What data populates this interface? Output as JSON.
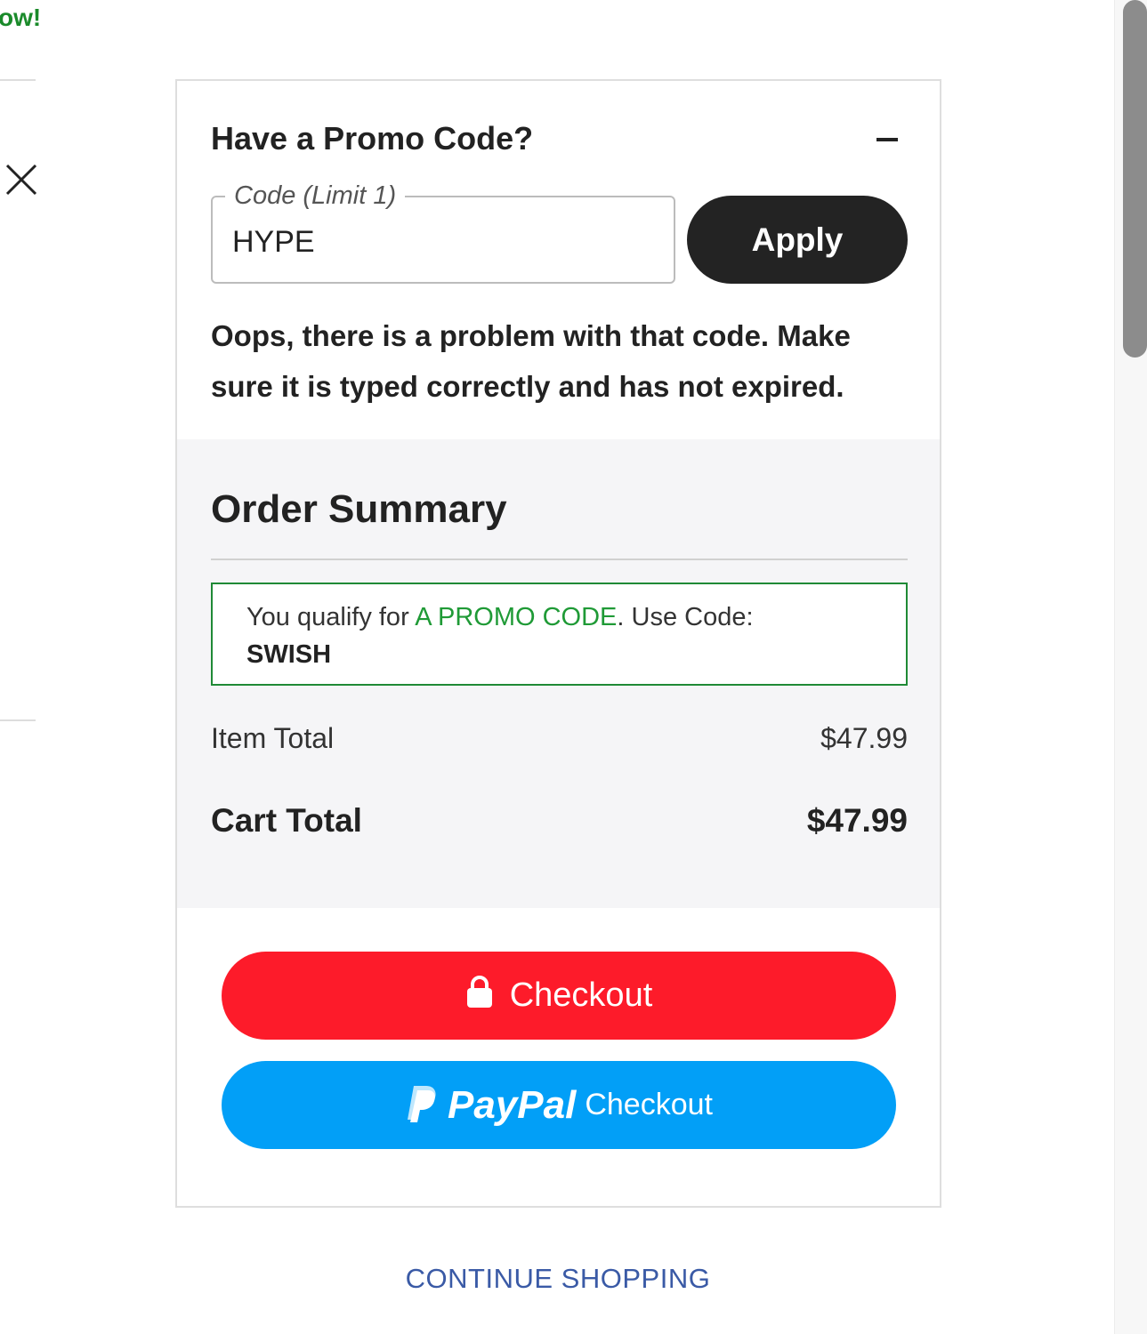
{
  "background": {
    "left_fragment_text": "ow!"
  },
  "promo": {
    "title": "Have a Promo Code?",
    "code_label": "Code (Limit 1)",
    "code_value": "HYPE",
    "apply_label": "Apply",
    "error_message": "Oops, there is a problem with that code. Make sure it is typed correctly and has not expired."
  },
  "summary": {
    "title": "Order Summary",
    "qualify_prefix": "You qualify for ",
    "qualify_highlight": "A PROMO CODE",
    "qualify_suffix": ". Use Code:",
    "qualify_code": "SWISH",
    "item_total_label": "Item Total",
    "item_total_value": "$47.99",
    "cart_total_label": "Cart Total",
    "cart_total_value": "$47.99"
  },
  "actions": {
    "checkout_label": "Checkout",
    "paypal_brand": "PayPal",
    "paypal_label": "Checkout",
    "continue_label": "CONTINUE SHOPPING"
  },
  "colors": {
    "checkout_red": "#fd1b2a",
    "paypal_blue": "#029ff7",
    "promo_green": "#1f8a36",
    "link_blue": "#3a5aa6"
  },
  "icons": [
    "close-icon",
    "minus-icon",
    "lock-icon",
    "paypal-logo-icon"
  ]
}
